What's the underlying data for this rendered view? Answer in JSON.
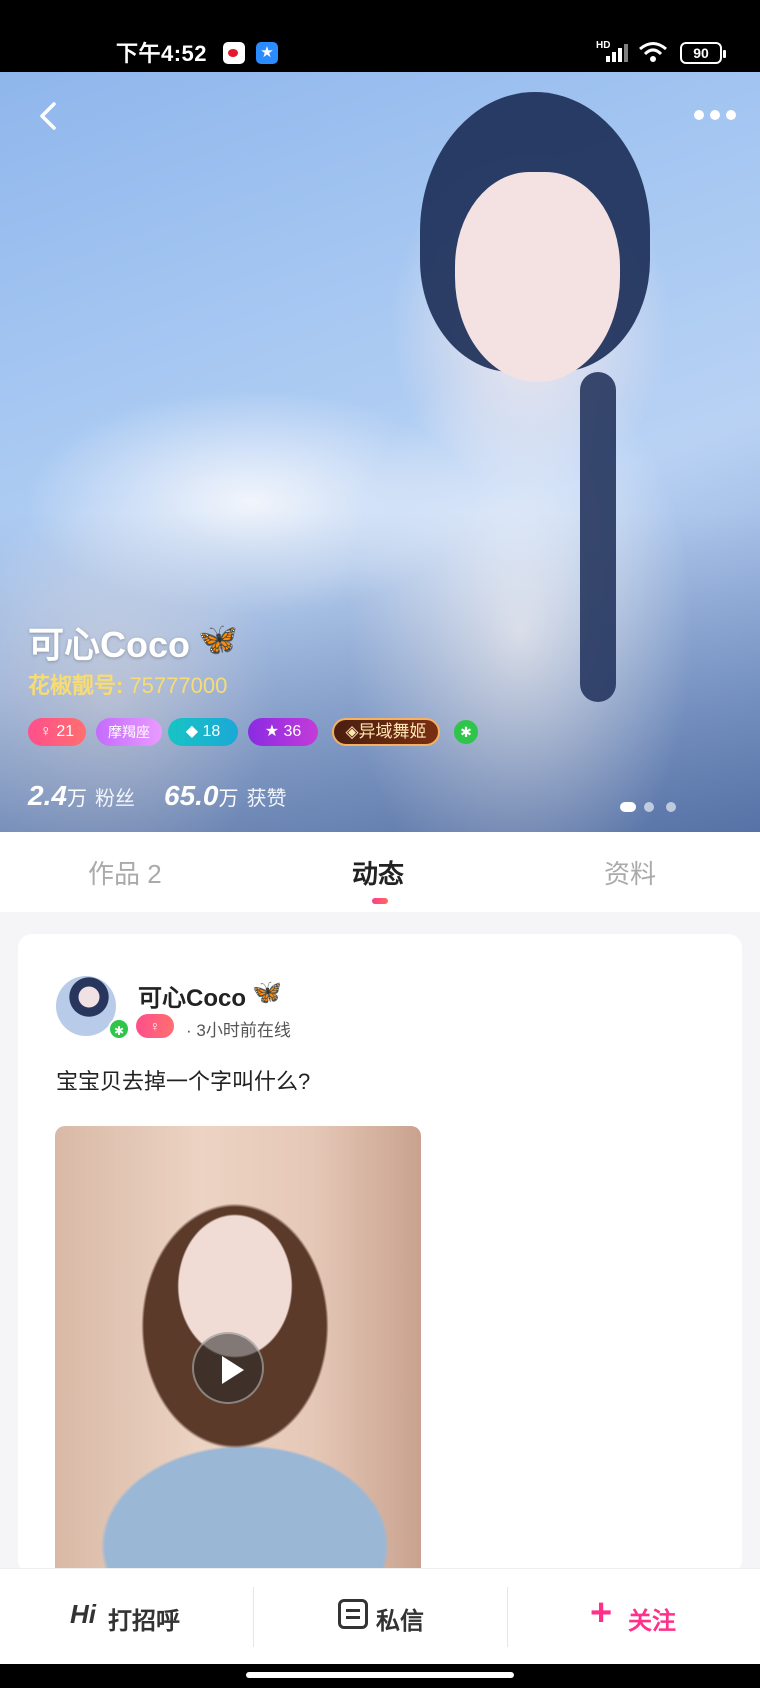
{
  "status_bar": {
    "time": "下午4:52",
    "network": "HD",
    "battery": "90"
  },
  "profile": {
    "nickname": "可心Coco",
    "nickname_emoji": "🦋",
    "beauty_id_label": "花椒靓号:",
    "beauty_id_value": " 75777000",
    "badges": {
      "gender_level": "21",
      "zodiac": "摩羯座",
      "diamond": "18",
      "star_level": "36",
      "title": "异域舞姬"
    },
    "stats": {
      "fans_num": "2.4",
      "fans_unit": "万",
      "fans_label": "粉丝",
      "likes_num": "65.0",
      "likes_unit": "万",
      "likes_label": "获赞"
    },
    "carousel_pages": 3,
    "carousel_active": 1
  },
  "tabs": {
    "works": "作品 2",
    "moments": "动态",
    "profile": "资料",
    "active": "moments"
  },
  "post": {
    "author": "可心Coco",
    "author_emoji": "🦋",
    "online_status": "· 3小时前在线",
    "text": "宝宝贝去掉一个字叫什么?"
  },
  "bottom_bar": {
    "hi_icon": "Hi",
    "greet": "打招呼",
    "message": "私信",
    "follow_icon": "+",
    "follow": "关注"
  },
  "colors": {
    "accent": "#ff2f8a",
    "id_gold": "#f7dc74",
    "verified": "#2fc44a"
  }
}
